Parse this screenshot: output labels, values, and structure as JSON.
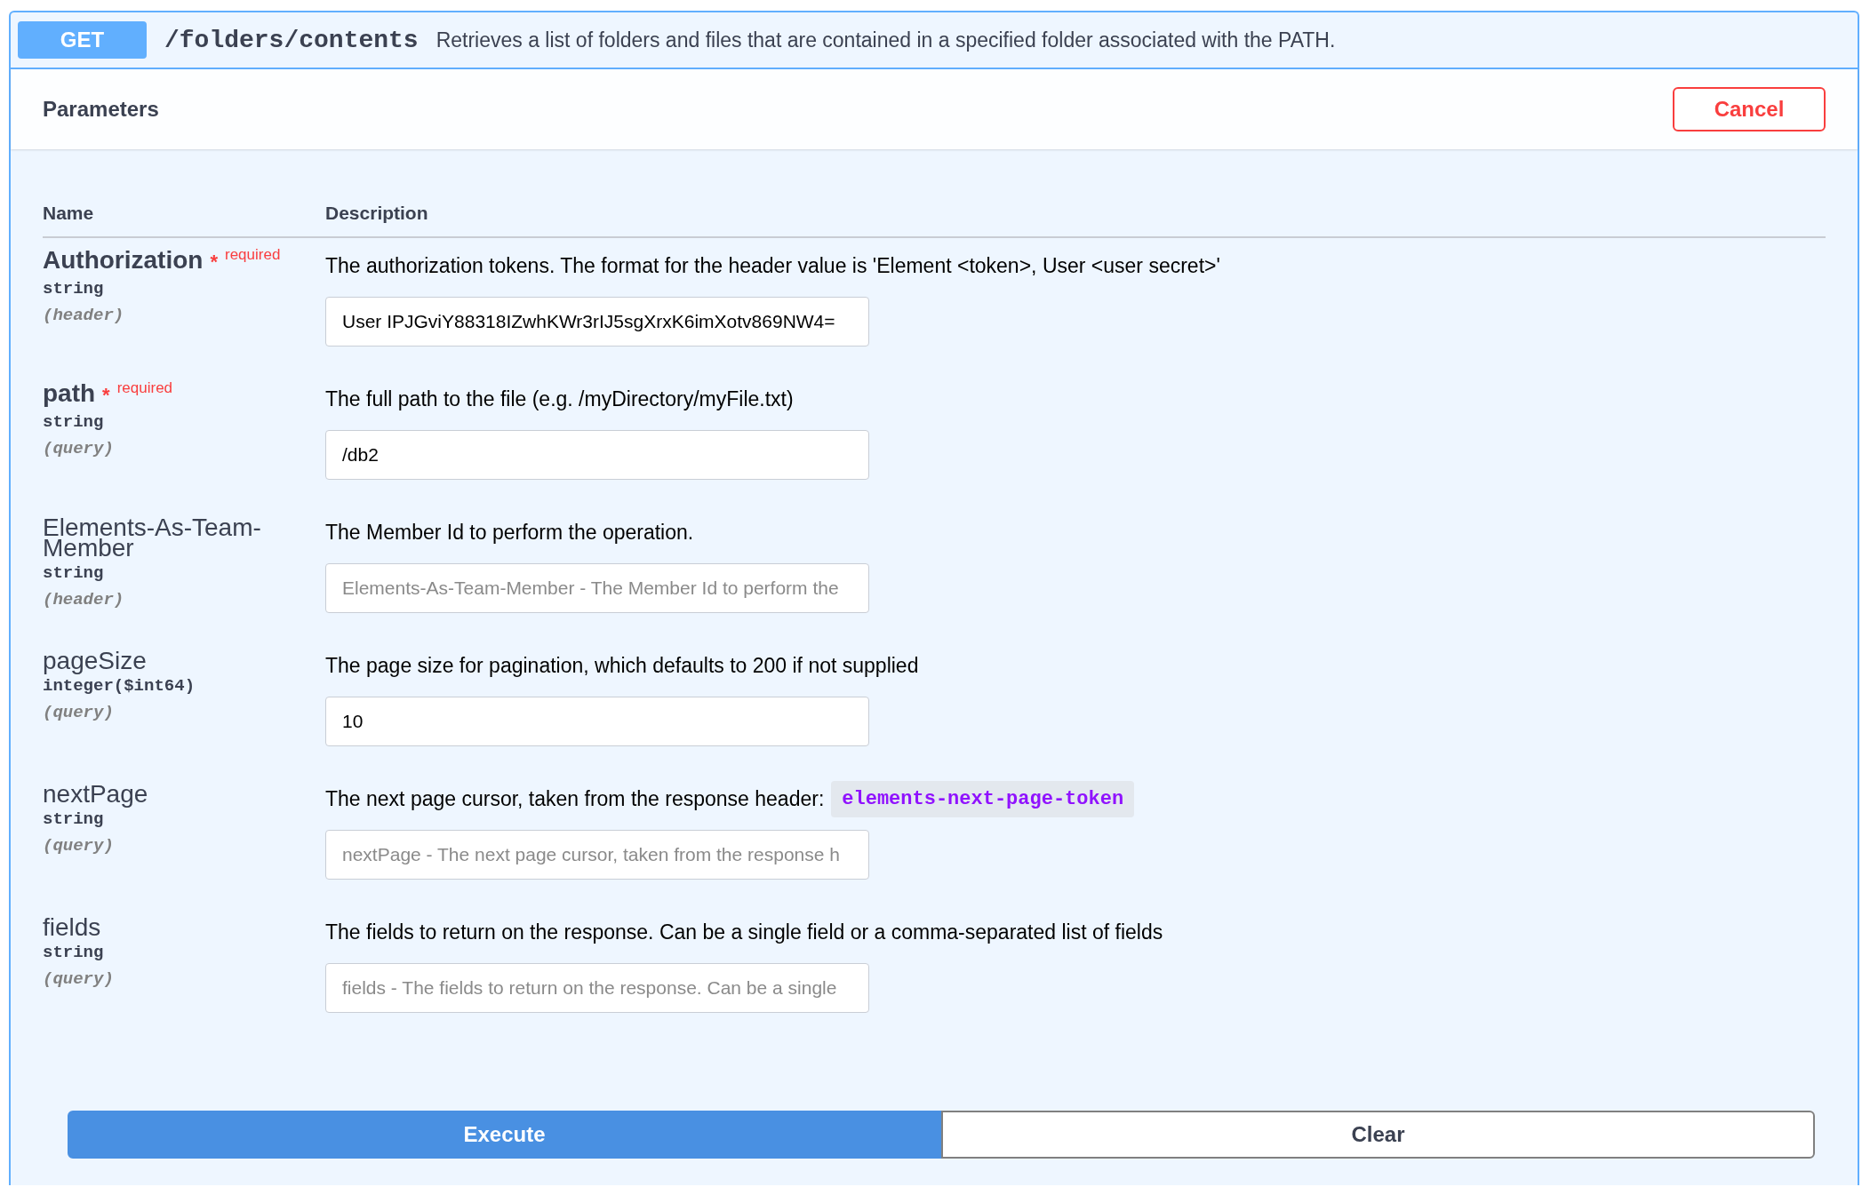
{
  "endpoint": {
    "method": "GET",
    "path": "/folders/contents",
    "summary": "Retrieves a list of folders and files that are contained in a specified folder associated with the PATH."
  },
  "parameters_bar": {
    "title": "Parameters",
    "cancel_button": "Cancel"
  },
  "table": {
    "columns": [
      "Name",
      "Description"
    ],
    "rows": [
      {
        "name": "Authorization",
        "required": true,
        "required_mark": "*",
        "required_label": "required",
        "type": "string",
        "location": "(header)",
        "description": "The authorization tokens. The format for the header value is 'Element <token>, User <user secret>'",
        "value": "User IPJGviY88318IZwhKWr3rIJ5sgXrxK6imXotv869NW4="
      },
      {
        "name": "path",
        "required": true,
        "required_mark": "*",
        "required_label": "required",
        "type": "string",
        "location": "(query)",
        "description": "The full path to the file (e.g. /myDirectory/myFile.txt)",
        "value": "/db2"
      },
      {
        "name": "Elements-As-Team-Member",
        "required": false,
        "type": "string",
        "location": "(header)",
        "description": "The Member Id to perform the operation.",
        "placeholder": "Elements-As-Team-Member - The Member Id to perform the"
      },
      {
        "name": "pageSize",
        "required": false,
        "type": "integer($int64)",
        "location": "(query)",
        "description": "The page size for pagination, which defaults to 200 if not supplied",
        "value": "10"
      },
      {
        "name": "nextPage",
        "required": false,
        "type": "string",
        "location": "(query)",
        "description": "The next page cursor, taken from the response header:",
        "code": "elements-next-page-token",
        "placeholder": "nextPage - The next page cursor, taken from the response h"
      },
      {
        "name": "fields",
        "required": false,
        "type": "string",
        "location": "(query)",
        "description": "The fields to return on the response. Can be a single field or a comma-separated list of fields",
        "placeholder": "fields - The fields to return on the response. Can be a single"
      }
    ]
  },
  "actions": {
    "execute": "Execute",
    "clear": "Clear"
  }
}
